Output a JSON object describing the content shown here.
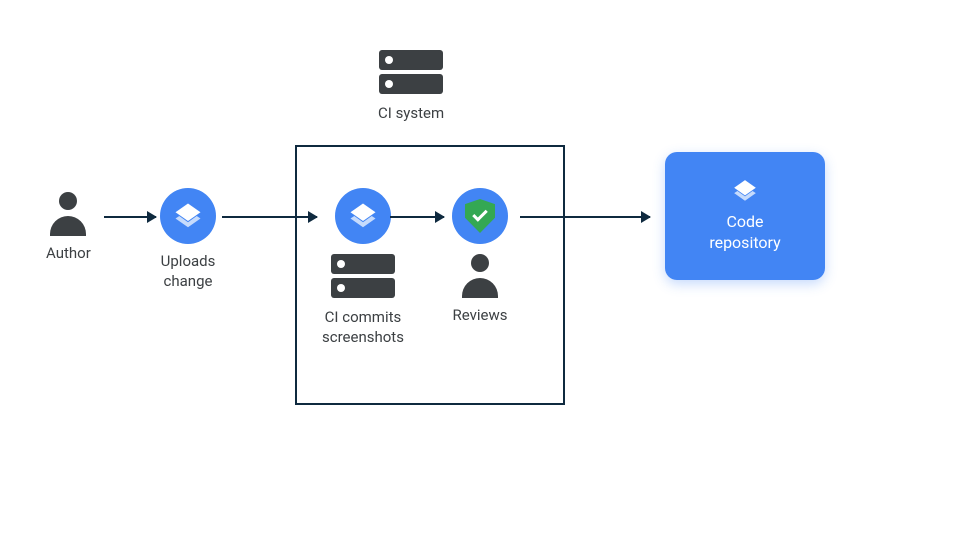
{
  "nodes": {
    "ci_system": {
      "label": "CI system"
    },
    "author": {
      "label": "Author"
    },
    "uploads_change": {
      "label": "Uploads\nchange"
    },
    "ci_commits": {
      "label": "CI commits\nscreenshots"
    },
    "reviews": {
      "label": "Reviews"
    },
    "code_repo": {
      "label": "Code\nrepository"
    }
  },
  "colors": {
    "accent": "#4285f4",
    "dark": "#3c4043",
    "border": "#0f2a3f",
    "shield": "#34a853"
  },
  "icons": {
    "layers": "layers-icon",
    "shield_check": "shield-check-icon",
    "server": "server-icon",
    "person": "person-icon"
  }
}
